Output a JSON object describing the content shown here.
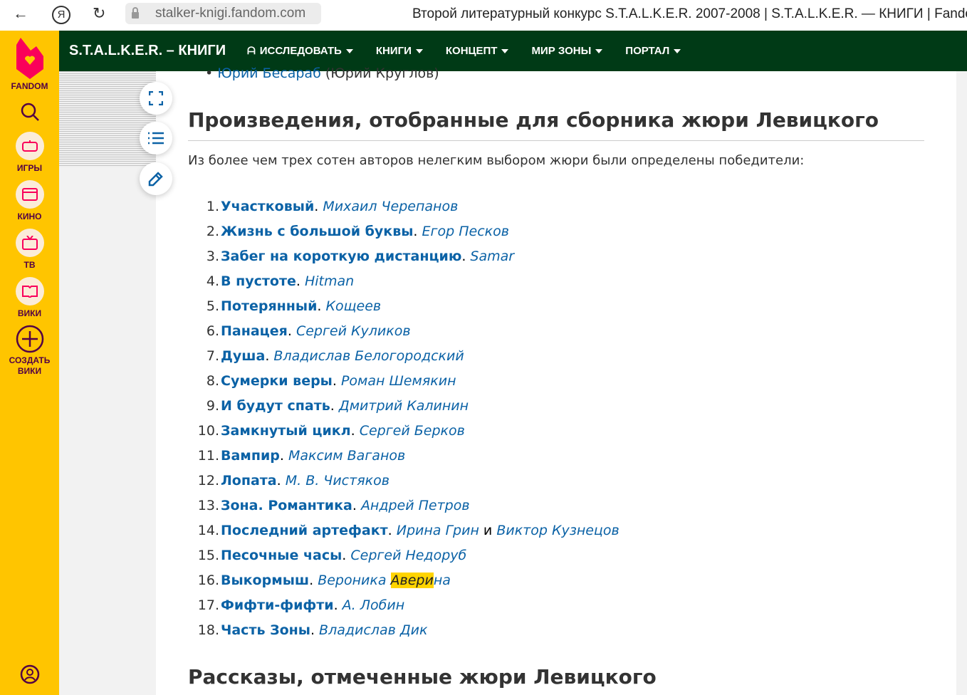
{
  "browser": {
    "url": "stalker-knigi.fandom.com",
    "title": "Второй литературный конкурс S.T.A.L.K.E.R. 2007-2008 | S.T.A.L.K.E.R. — КНИГИ | Fandom"
  },
  "fandom": {
    "logo": "FANDOM",
    "items": [
      {
        "label": "ИГРЫ"
      },
      {
        "label": "КИНО"
      },
      {
        "label": "ТВ"
      },
      {
        "label": "ВИКИ"
      }
    ],
    "create": "СОЗДАТЬ ВИКИ"
  },
  "header": {
    "site": "S.T.A.L.K.E.R. – КНИГИ",
    "nav": [
      "ИССЛЕДОВАТЬ",
      "КНИГИ",
      "КОНЦЕПТ",
      "МИР ЗОНЫ",
      "ПОРТАЛ"
    ]
  },
  "content": {
    "prev_bullet": {
      "link": "Юрий Бесараб",
      "rest": " (Юрий Круглов)"
    },
    "heading1": "Произведения, отобранные для сборника жюри Левицкого",
    "intro": "Из более чем трех сотен авторов нелегким выбором жюри были определены победители:",
    "works": [
      {
        "n": "1.",
        "title": "Участковый",
        "author": "Михаил Черепанов"
      },
      {
        "n": "2.",
        "title": "Жизнь с большой буквы",
        "author": "Егор Песков"
      },
      {
        "n": "3.",
        "title": "Забег на короткую дистанцию",
        "author": "Samar"
      },
      {
        "n": "4.",
        "title": "В пустоте",
        "author": "Hitman"
      },
      {
        "n": "5.",
        "title": "Потерянный",
        "author": "Кощеев"
      },
      {
        "n": "6.",
        "title": "Панацея",
        "author": "Сергей Куликов"
      },
      {
        "n": "7.",
        "title": "Душа",
        "author": "Владислав Белогородский"
      },
      {
        "n": "8.",
        "title": "Сумерки веры",
        "author": "Роман Шемякин"
      },
      {
        "n": "9.",
        "title": "И будут спать",
        "author": "Дмитрий Калинин"
      },
      {
        "n": "10.",
        "title": "Замкнутый цикл",
        "author": "Сергей Берков"
      },
      {
        "n": "11.",
        "title": "Вампир",
        "author": "Максим Ваганов"
      },
      {
        "n": "12.",
        "title": "Лопата",
        "author": "М. В. Чистяков"
      },
      {
        "n": "13.",
        "title": "Зона. Романтика",
        "author": "Андрей Петров"
      },
      {
        "n": "14.",
        "title": "Последний артефакт",
        "author": "Ирина Грин",
        "conj": " и ",
        "author2": "Виктор Кузнецов"
      },
      {
        "n": "15.",
        "title": "Песочные часы",
        "author": "Сергей Недоруб"
      },
      {
        "n": "16.",
        "title": "Выкормыш",
        "author": "Вероника ",
        "hl": "Авери",
        "author_end": "на"
      },
      {
        "n": "17.",
        "title": "Фифти-фифти",
        "author": "А. Лобин"
      },
      {
        "n": "18.",
        "title": "Часть Зоны",
        "author": "Владислав Дик"
      }
    ],
    "heading2": "Рассказы, отмеченные жюри Левицкого"
  },
  "colors": {
    "fandom": "#ffc500",
    "header": "#003a16",
    "link": "#0b62a6"
  }
}
